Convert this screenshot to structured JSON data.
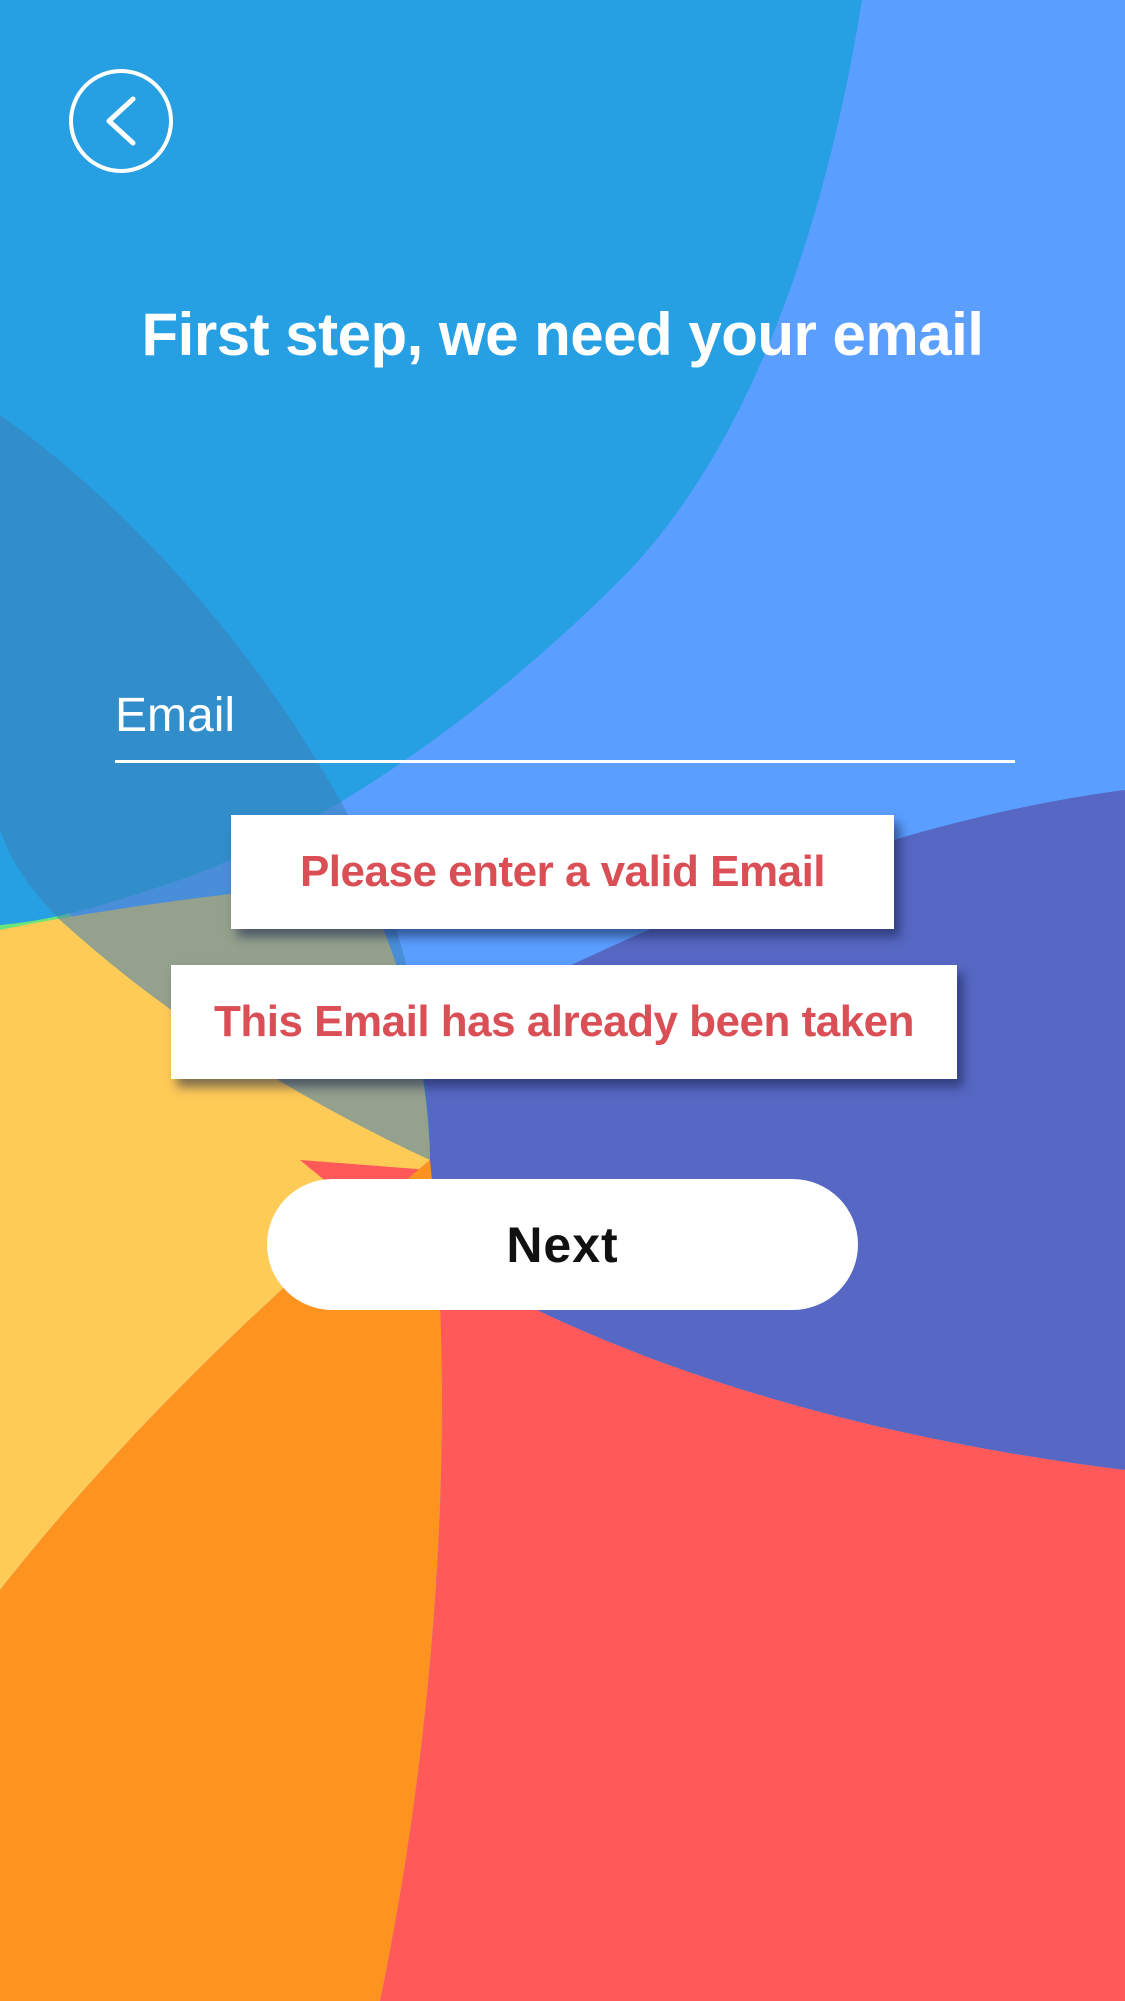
{
  "header": {
    "back_icon": "chevron-left-icon",
    "title": "First step, we need your email"
  },
  "form": {
    "email_placeholder": "Email",
    "email_value": ""
  },
  "errors": [
    {
      "message": "Please enter a valid Email"
    },
    {
      "message": "This Email has already been taken"
    }
  ],
  "actions": {
    "next_label": "Next"
  },
  "colors": {
    "background_blue": "#5a9fff",
    "blue_blob": "#279fe3",
    "indigo_blob": "#5768c4",
    "red_blob": "#ff5959",
    "orange_blob": "#ff931f",
    "yellow_blob": "#ffcb57",
    "green_blob": "#6fe872",
    "error_text": "#d94f55"
  }
}
